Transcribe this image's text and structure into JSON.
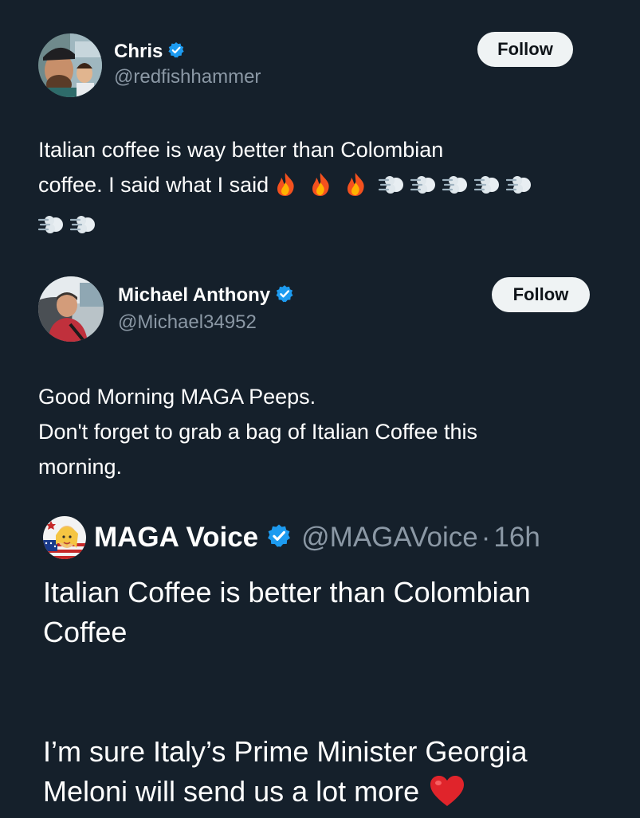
{
  "tweets": [
    {
      "display_name": "Chris",
      "handle": "@redfishhammer",
      "follow_label": "Follow",
      "text_line1": "Italian coffee is way better than Colombian",
      "text_line2": "coffee. I said what I said"
    },
    {
      "display_name": "Michael Anthony",
      "handle": "@Michael34952",
      "follow_label": "Follow",
      "text_lines": [
        "Good Morning MAGA Peeps.",
        "Don't forget to grab a bag of Italian Coffee this",
        "morning."
      ]
    }
  ],
  "quote": {
    "display_name": "MAGA Voice",
    "handle": "@MAGAVoice",
    "separator": "·",
    "time": "16h",
    "text_lines": [
      "Italian Coffee is better than Colombian",
      "Coffee",
      "I’m sure Italy’s Prime Minister Georgia",
      "Meloni will send us a lot more"
    ]
  },
  "colors": {
    "background": "#15202b",
    "text": "#ffffff",
    "secondary": "#8b98a5",
    "verified": "#1d9bf0",
    "follow_bg": "#eff3f4"
  },
  "icons": {
    "verified": "verified-badge-icon",
    "fire": "fire-emoji",
    "dash": "dashing-away-emoji",
    "heart": "red-heart-emoji"
  }
}
